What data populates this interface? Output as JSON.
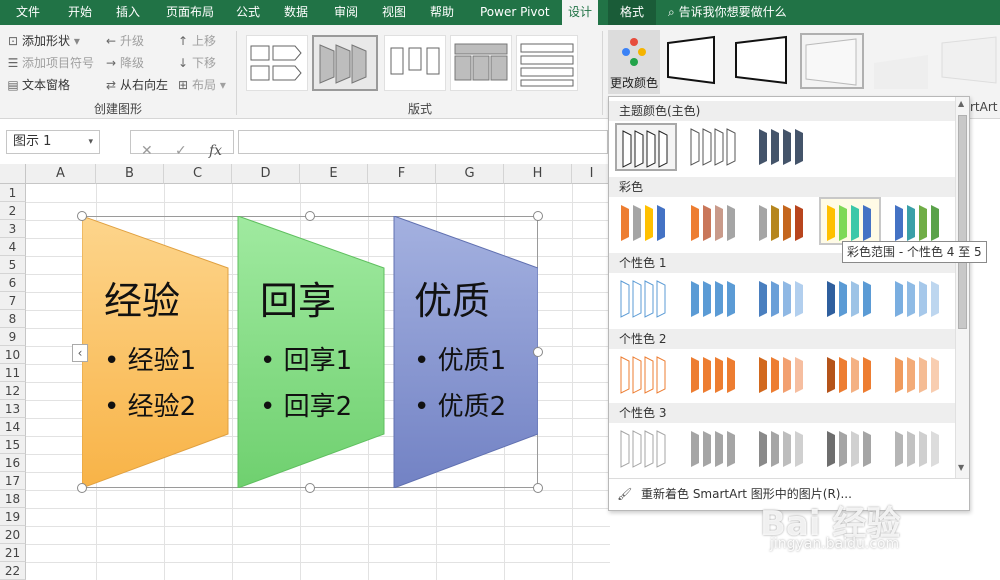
{
  "tabs": [
    "文件",
    "开始",
    "插入",
    "页面布局",
    "公式",
    "数据",
    "审阅",
    "视图",
    "帮助",
    "Power Pivot",
    "设计",
    "格式"
  ],
  "tell_me": "告诉我你想要做什么",
  "create_group": {
    "add_shape": "添加形状",
    "add_bullet": "添加项目符号",
    "text_pane": "文本窗格",
    "promote": "升级",
    "demote": "降级",
    "right_to_left": "从右向左",
    "move_up": "上移",
    "move_down": "下移",
    "layout": "布局",
    "label": "创建图形"
  },
  "layouts_group": {
    "label": "版式"
  },
  "change_colors": "更改颜色",
  "smartart_partial": "rtArt",
  "name_box": "图示 1",
  "columns": [
    "A",
    "B",
    "C",
    "D",
    "E",
    "F",
    "G",
    "H",
    "I"
  ],
  "rows": [
    "1",
    "2",
    "3",
    "4",
    "5",
    "6",
    "7",
    "8",
    "9",
    "10",
    "11",
    "12",
    "13",
    "14",
    "15",
    "16",
    "17",
    "18",
    "19",
    "20",
    "21",
    "22"
  ],
  "smartart": {
    "boxes": [
      {
        "title": "经验",
        "items": [
          "经验1",
          "经验2"
        ],
        "color": "#fbbf5f"
      },
      {
        "title": "回享",
        "items": [
          "回享1",
          "回享2"
        ],
        "color": "#7fdd7f"
      },
      {
        "title": "优质",
        "items": [
          "优质1",
          "优质2"
        ],
        "color": "#7f91cc"
      }
    ]
  },
  "color_panel": {
    "sections": [
      "主题颜色(主色)",
      "彩色",
      "个性色 1",
      "个性色 2",
      "个性色 3"
    ],
    "tooltip": "彩色范围 - 个性色 4 至 5",
    "recolor": "重新着色 SmartArt 图形中的图片(R)..."
  },
  "watermark": "Bai 经验",
  "watermark_url": "jingyan.baidu.com"
}
